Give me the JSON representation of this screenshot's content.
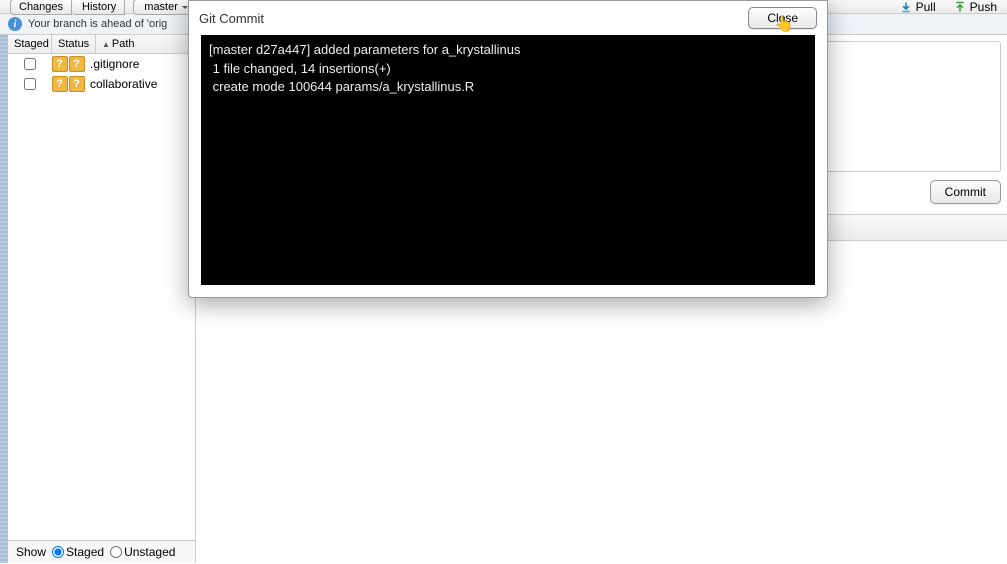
{
  "toolbar": {
    "tab_changes": "Changes",
    "tab_history": "History",
    "branch": "master",
    "pull_label": "Pull",
    "push_label": "Push"
  },
  "info_bar": {
    "text": "Your branch is ahead of 'orig"
  },
  "file_table": {
    "col_staged": "Staged",
    "col_status": "Status",
    "col_path": "Path",
    "rows": [
      {
        "name": ".gitignore"
      },
      {
        "name": "collaborative"
      }
    ]
  },
  "show_bar": {
    "label": "Show",
    "staged": "Staged",
    "unstaged": "Unstaged"
  },
  "commit_button": "Commit",
  "modal": {
    "title": "Git Commit",
    "close": "Close",
    "terminal_line1": "[master d27a447] added parameters for a_krystallinus",
    "terminal_line2": " 1 file changed, 14 insertions(+)",
    "terminal_line3": " create mode 100644 params/a_krystallinus.R"
  }
}
